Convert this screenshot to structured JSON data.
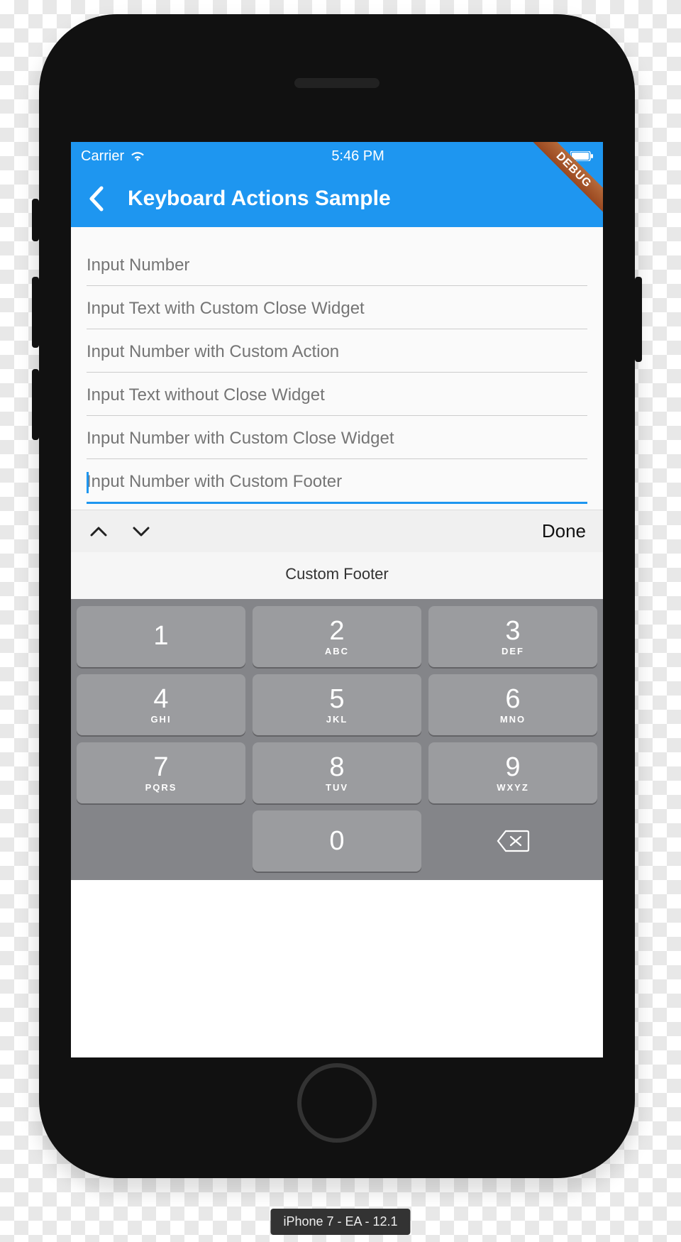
{
  "statusbar": {
    "carrier": "Carrier",
    "time": "5:46 PM"
  },
  "appbar": {
    "title": "Keyboard Actions Sample",
    "debug": "DEBUG"
  },
  "fields": [
    {
      "placeholder": "Input Number"
    },
    {
      "placeholder": "Input Text with Custom Close Widget"
    },
    {
      "placeholder": "Input Number with Custom Action"
    },
    {
      "placeholder": "Input Text without Close Widget"
    },
    {
      "placeholder": "Input Number with Custom Close Widget"
    },
    {
      "placeholder": "Input Number with Custom Footer"
    }
  ],
  "toolbar": {
    "done": "Done"
  },
  "footer": {
    "label": "Custom Footer"
  },
  "keypad": [
    {
      "digit": "1",
      "letters": ""
    },
    {
      "digit": "2",
      "letters": "ABC"
    },
    {
      "digit": "3",
      "letters": "DEF"
    },
    {
      "digit": "4",
      "letters": "GHI"
    },
    {
      "digit": "5",
      "letters": "JKL"
    },
    {
      "digit": "6",
      "letters": "MNO"
    },
    {
      "digit": "7",
      "letters": "PQRS"
    },
    {
      "digit": "8",
      "letters": "TUV"
    },
    {
      "digit": "9",
      "letters": "WXYZ"
    },
    {
      "digit": "0",
      "letters": ""
    }
  ],
  "simulator": {
    "label": "iPhone 7 - EA - 12.1"
  }
}
